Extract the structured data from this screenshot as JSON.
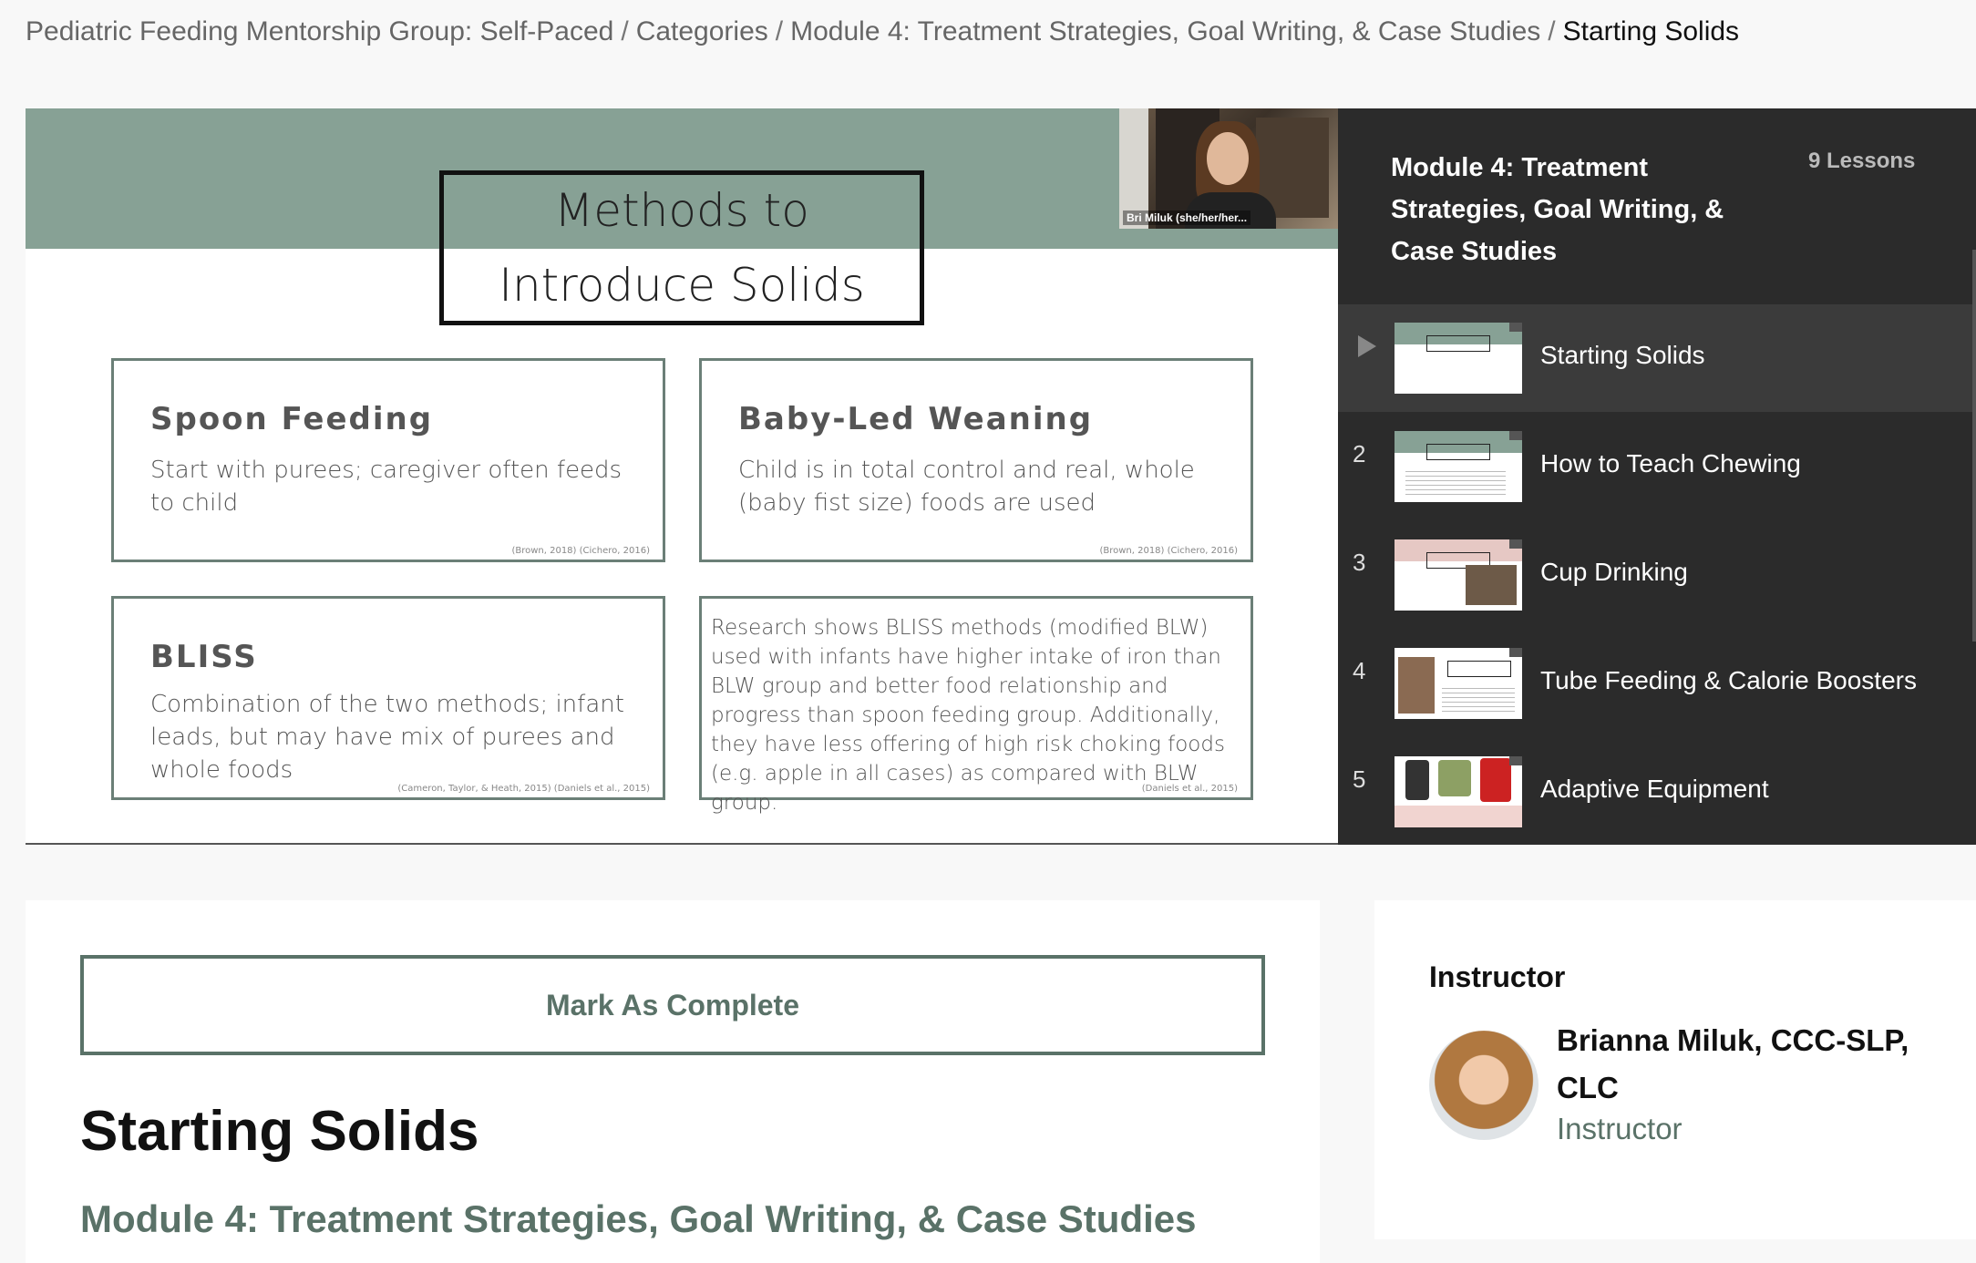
{
  "breadcrumb": {
    "items": [
      "Pediatric Feeding Mentorship Group: Self-Paced",
      "Categories",
      "Module 4: Treatment Strategies, Goal Writing, & Case Studies"
    ],
    "current": "Starting Solids",
    "separator": "/"
  },
  "slide": {
    "title_line1": "Methods to",
    "title_line2": "Introduce Solids",
    "webcam_label": "Bri Miluk (she/her/her...",
    "cards": [
      {
        "heading": "Spoon Feeding",
        "text": "Start with purees; caregiver often feeds to child",
        "cite": "(Brown, 2018) (Cichero, 2016)"
      },
      {
        "heading": "Baby-Led Weaning",
        "text": "Child is in total control and real, whole (baby fist size) foods are used",
        "cite": "(Brown, 2018) (Cichero, 2016)"
      },
      {
        "heading": "BLISS",
        "text": "Combination of the two methods; infant leads, but may have mix of purees and whole foods",
        "cite": "(Cameron, Taylor, & Heath, 2015) (Daniels et al., 2015)"
      },
      {
        "heading": "",
        "text": "Research shows BLISS methods (modified BLW) used with infants have higher intake of iron than BLW group and better food relationship and progress than spoon feeding group. Additionally, they have less offering of high risk choking foods (e.g. apple in all cases) as compared with BLW group.",
        "cite": "(Daniels et al., 2015)"
      }
    ],
    "accent_color": "#87a195"
  },
  "playlist": {
    "module_title": "Module 4: Treatment Strategies, Goal Writing, & Case Studies",
    "lesson_count": "9 Lessons",
    "lessons": [
      {
        "number": "",
        "title": "Starting Solids",
        "active": true
      },
      {
        "number": "2",
        "title": "How to Teach Chewing",
        "active": false
      },
      {
        "number": "3",
        "title": "Cup Drinking",
        "active": false
      },
      {
        "number": "4",
        "title": "Tube Feeding & Calorie Boosters",
        "active": false
      },
      {
        "number": "5",
        "title": "Adaptive Equipment",
        "active": false
      }
    ]
  },
  "lesson": {
    "complete_label": "Mark As Complete",
    "title": "Starting Solids",
    "module": "Module 4: Treatment Strategies, Goal Writing, & Case Studies"
  },
  "instructor": {
    "heading": "Instructor",
    "name": "Brianna Miluk, CCC-SLP, CLC",
    "role": "Instructor"
  },
  "colors": {
    "brand": "#5a7268",
    "playlist_bg": "#2b2b2b"
  }
}
